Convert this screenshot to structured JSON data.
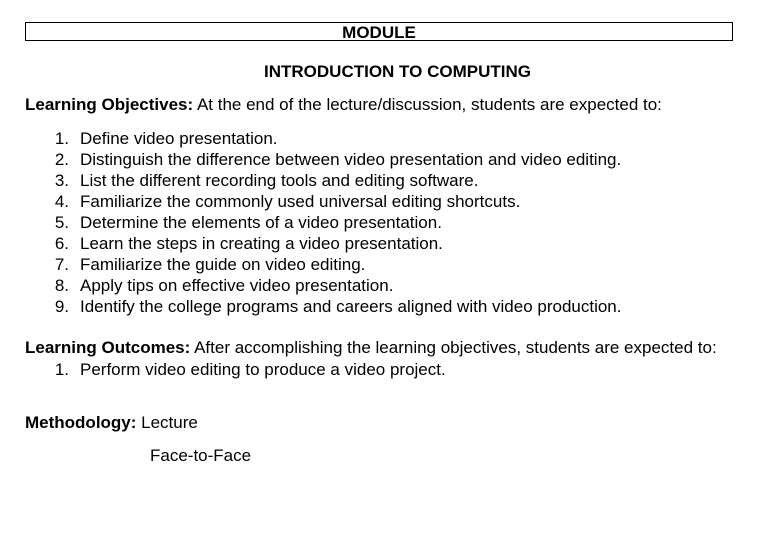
{
  "header": {
    "module_label": "MODULE",
    "title": "INTRODUCTION TO COMPUTING"
  },
  "objectives": {
    "label": "Learning Objectives:",
    "intro": " At the end of the lecture/discussion, students are expected to:",
    "items": [
      {
        "num": "1.",
        "text": "Define video presentation."
      },
      {
        "num": "2.",
        "text": "Distinguish the difference between video presentation and video editing."
      },
      {
        "num": "3.",
        "text": "List the different recording tools and editing software."
      },
      {
        "num": "4.",
        "text": "Familiarize the commonly used universal editing shortcuts."
      },
      {
        "num": "5.",
        "text": "Determine the elements of a video presentation."
      },
      {
        "num": "6.",
        "text": "Learn the steps in creating a video presentation."
      },
      {
        "num": "7.",
        "text": "Familiarize the guide on video editing."
      },
      {
        "num": "8.",
        "text": "Apply tips on effective video presentation."
      },
      {
        "num": "9.",
        "text": "Identify the college programs and careers aligned with video production."
      }
    ]
  },
  "outcomes": {
    "label": "Learning Outcomes:",
    "intro": " After accomplishing the learning objectives, students are expected to:",
    "items": [
      {
        "num": "1.",
        "text": "Perform video editing to produce a video project."
      }
    ]
  },
  "methodology": {
    "label": "Methodology:",
    "first": " Lecture",
    "second": "Face-to-Face"
  }
}
